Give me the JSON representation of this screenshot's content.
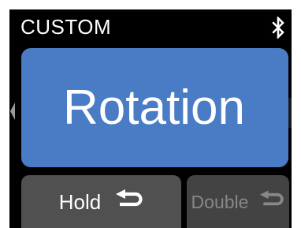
{
  "screen": {
    "title": "CUSTOM",
    "status_icon": "bluetooth-icon",
    "nav_left_icon": "chevron-left-icon"
  },
  "main": {
    "label": "Rotation",
    "accent": "#4a7cc6"
  },
  "buttons": [
    {
      "label": "Hold",
      "icon": "return-arrow-icon",
      "state": "active"
    },
    {
      "label": "Double",
      "icon": "return-arrow-icon",
      "state": "dimmed"
    }
  ],
  "colors": {
    "background": "#000000",
    "button_active": "#505050",
    "button_dimmed": "#434343",
    "text": "#ffffff",
    "text_dimmed": "#888888"
  }
}
